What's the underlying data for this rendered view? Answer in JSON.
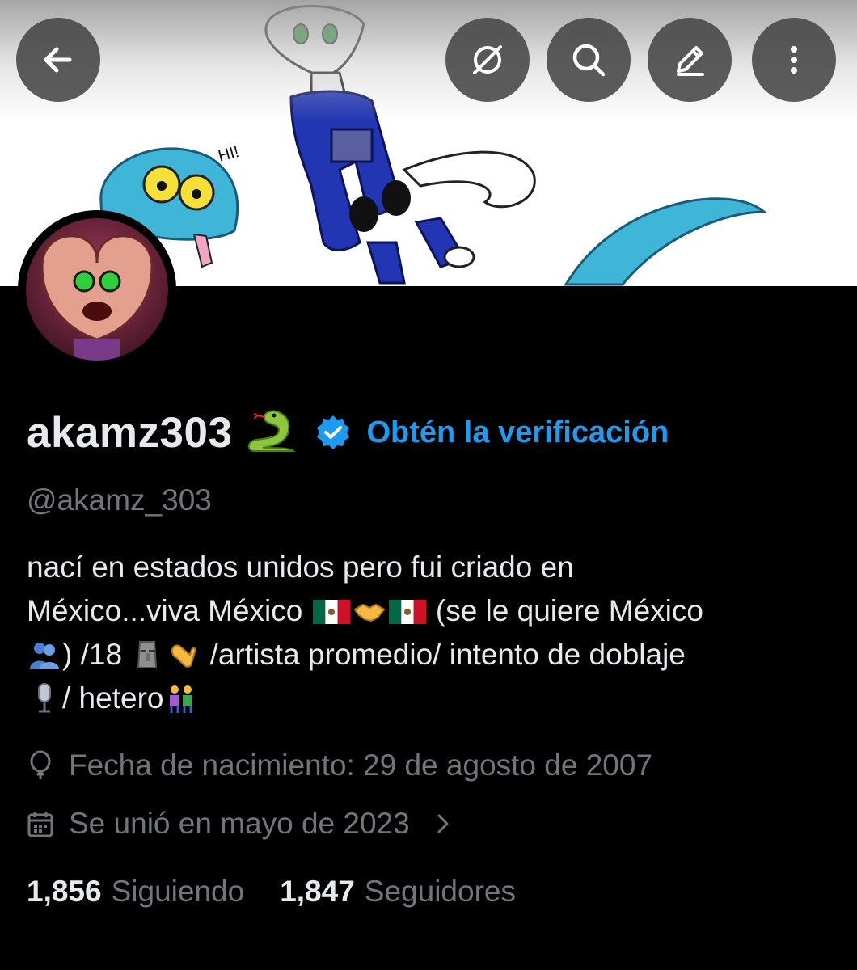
{
  "profile": {
    "display_name": "akamz303",
    "get_verified_label": "Obtén la verificación",
    "handle": "@akamz_303",
    "bio": {
      "line1": "nací en estados unidos pero fui criado en",
      "line2_a": "México...viva México",
      "line2_b": "(se le quiere México",
      "line3_a": ") /18",
      "line3_b": "/artista promedio/ intento de doblaje",
      "line4_a": "/  hetero"
    },
    "birthday": "Fecha de nacimiento: 29 de agosto de 2007",
    "joined": "Se unió en mayo de 2023"
  },
  "stats": {
    "following_count": "1,856",
    "following_label": "Siguiendo",
    "followers_count": "1,847",
    "followers_label": "Seguidores"
  },
  "colors": {
    "accent": "#1d9bf0",
    "secondary_text": "#71767b",
    "primary_text": "#e7e9ea",
    "background": "#000000"
  },
  "icons": [
    "back-arrow-icon",
    "grok-icon",
    "search-icon",
    "edit-icon",
    "more-vertical-icon",
    "verified-badge-icon",
    "balloon-icon",
    "calendar-icon",
    "chevron-right-icon"
  ]
}
